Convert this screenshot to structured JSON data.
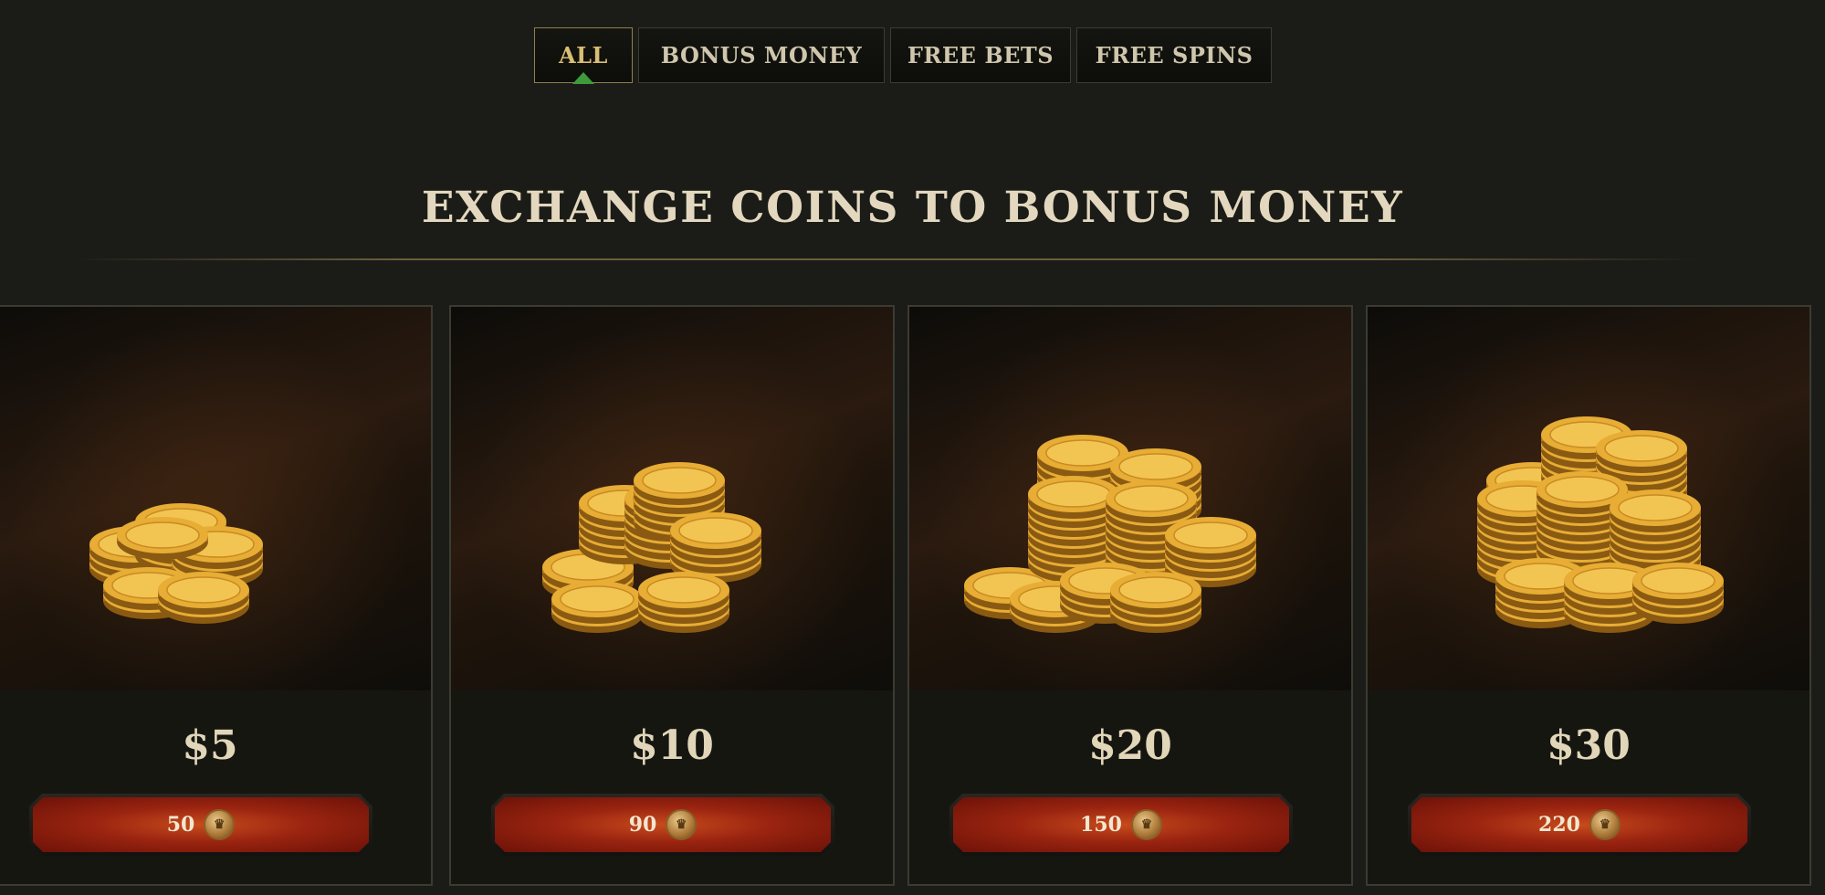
{
  "tabs": [
    {
      "label": "ALL",
      "active": true
    },
    {
      "label": "BONUS MONEY",
      "active": false
    },
    {
      "label": "FREE BETS",
      "active": false
    },
    {
      "label": "FREE SPINS",
      "active": false
    }
  ],
  "heading": "EXCHANGE COINS TO BONUS MONEY",
  "cards": [
    {
      "price": "$5",
      "cost": "50",
      "coin_icon": "coin-icon"
    },
    {
      "price": "$10",
      "cost": "90",
      "coin_icon": "coin-icon"
    },
    {
      "price": "$20",
      "cost": "150",
      "coin_icon": "coin-icon"
    },
    {
      "price": "$30",
      "cost": "220",
      "coin_icon": "coin-icon"
    }
  ],
  "colors": {
    "background": "#1b1c17",
    "active_tab_text": "#d9bd73",
    "active_tab_indicator": "#3f9a3a",
    "buy_button": "#9a2410",
    "gold": "#e3a93a"
  }
}
